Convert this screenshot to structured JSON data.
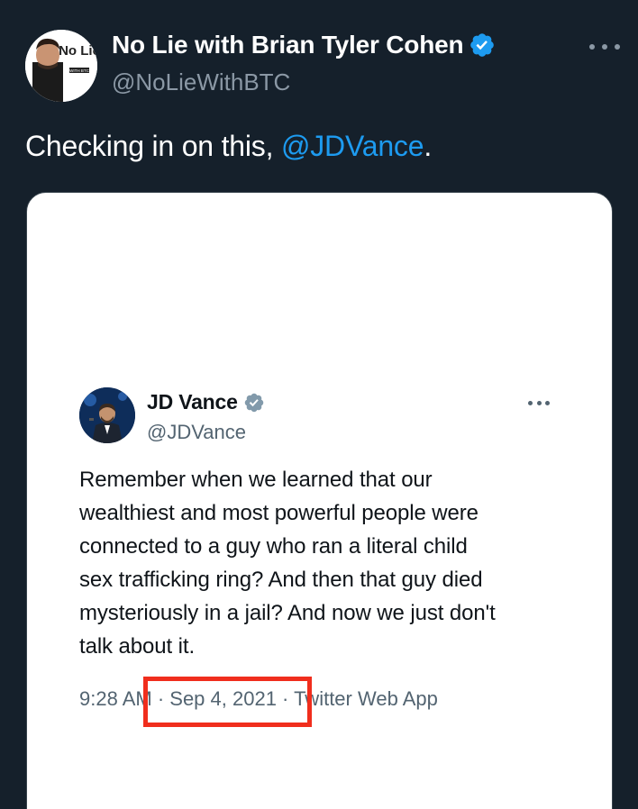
{
  "author": {
    "display_name": "No Lie with Brian Tyler Cohen",
    "handle": "@NoLieWithBTC",
    "avatar_logo_text": "No Lie",
    "avatar_small_text": "WITH BTC",
    "verified": true
  },
  "tweet": {
    "text_prefix": "Checking in on this, ",
    "mention": "@JDVance",
    "text_suffix": "."
  },
  "embedded_tweet": {
    "display_name": "JD Vance",
    "handle": "@JDVance",
    "verified": true,
    "text_lines": [
      "Remember when we learned that our",
      "wealthiest and most powerful people were",
      "connected to a guy who ran a literal child",
      "sex trafficking ring? And then that guy died",
      "mysteriously in a jail? And now we just don't",
      "talk about it."
    ],
    "meta": "9:28 AM · Sep 4, 2021 · Twitter Web App"
  },
  "colors": {
    "background": "#15202b",
    "accent": "#1d9bf0",
    "highlight_box": "#f02e1d",
    "secondary_text": "#8b98a5",
    "embedded_badge": "#829aab"
  },
  "icons": {
    "verified": "verified-badge-icon",
    "more": "more-options-icon"
  }
}
